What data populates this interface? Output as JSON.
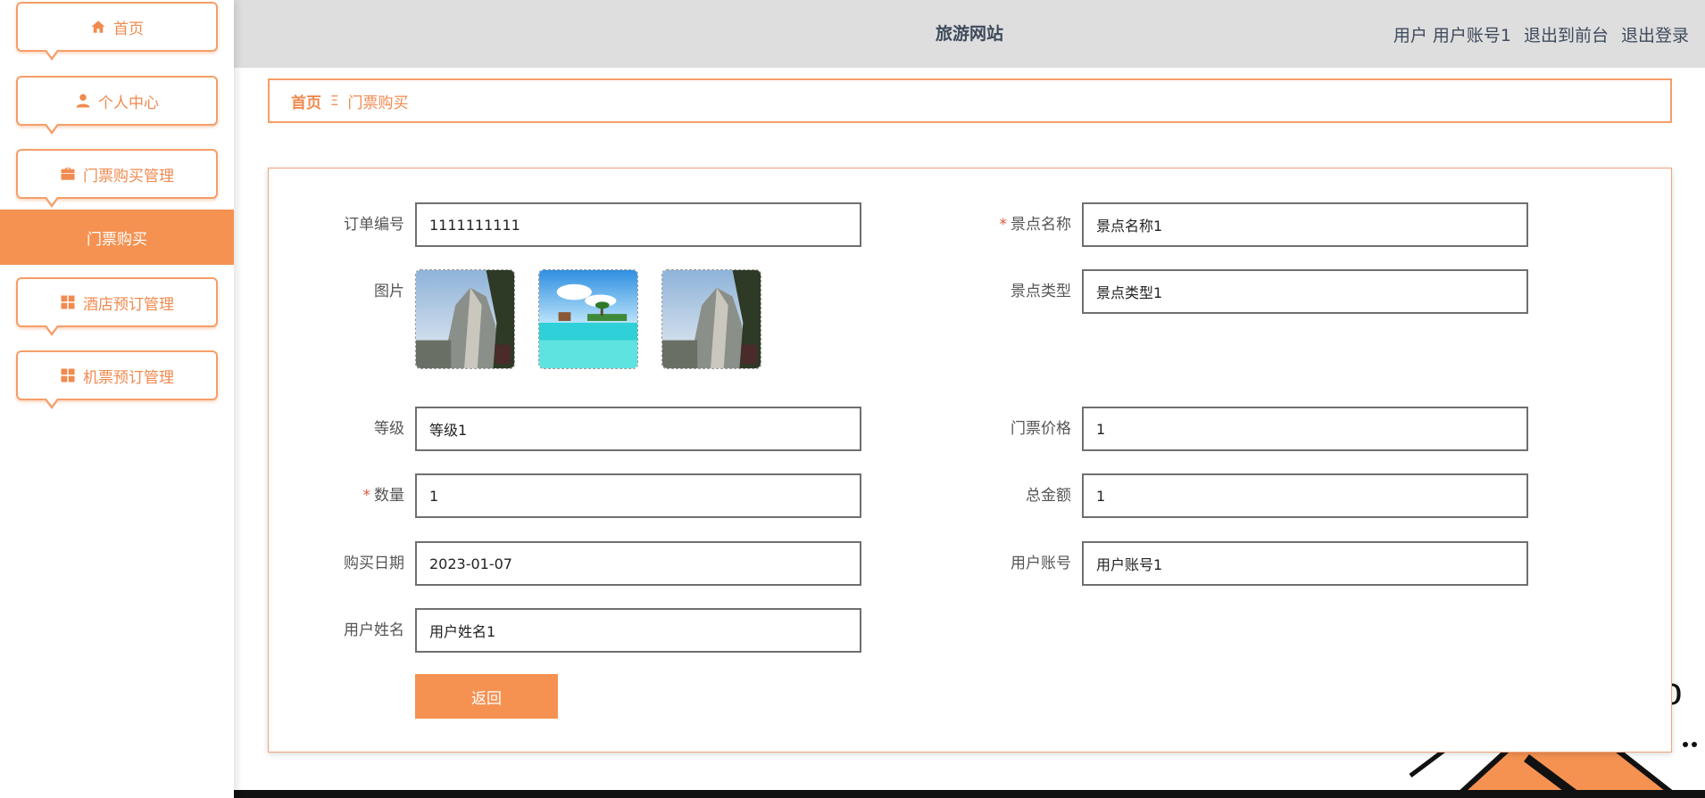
{
  "header": {
    "site_title": "旅游网站",
    "user_role": "用户",
    "user_account": "用户账号1",
    "exit_front": "退出到前台",
    "logout": "退出登录"
  },
  "sidebar": {
    "items": [
      {
        "label": "首页",
        "icon": "home-icon"
      },
      {
        "label": "个人中心",
        "icon": "user-icon"
      },
      {
        "label": "门票购买管理",
        "icon": "briefcase-icon"
      },
      {
        "label": "酒店预订管理",
        "icon": "grid-icon"
      },
      {
        "label": "机票预订管理",
        "icon": "grid-icon"
      }
    ],
    "active_submenu": "门票购买"
  },
  "breadcrumb": {
    "home": "首页",
    "separator": "Ξ",
    "current": "门票购买"
  },
  "form": {
    "order_no": {
      "label": "订单编号",
      "value": "1111111111"
    },
    "scenic_name": {
      "label": "景点名称",
      "value": "景点名称1",
      "required": true
    },
    "image": {
      "label": "图片"
    },
    "scenic_type": {
      "label": "景点类型",
      "value": "景点类型1"
    },
    "level": {
      "label": "等级",
      "value": "等级1"
    },
    "ticket_price": {
      "label": "门票价格",
      "value": "1"
    },
    "quantity": {
      "label": "数量",
      "value": "1",
      "required": true
    },
    "total": {
      "label": "总金额",
      "value": "1"
    },
    "purchase_date": {
      "label": "购买日期",
      "value": "2023-01-07"
    },
    "user_account": {
      "label": "用户账号",
      "value": "用户账号1"
    },
    "user_name": {
      "label": "用户姓名",
      "value": "用户姓名1"
    },
    "back_button": "返回",
    "required_mark": "*"
  },
  "colors": {
    "accent": "#f59252",
    "header_bg": "#dedede",
    "title_text": "#3e4a5c"
  }
}
